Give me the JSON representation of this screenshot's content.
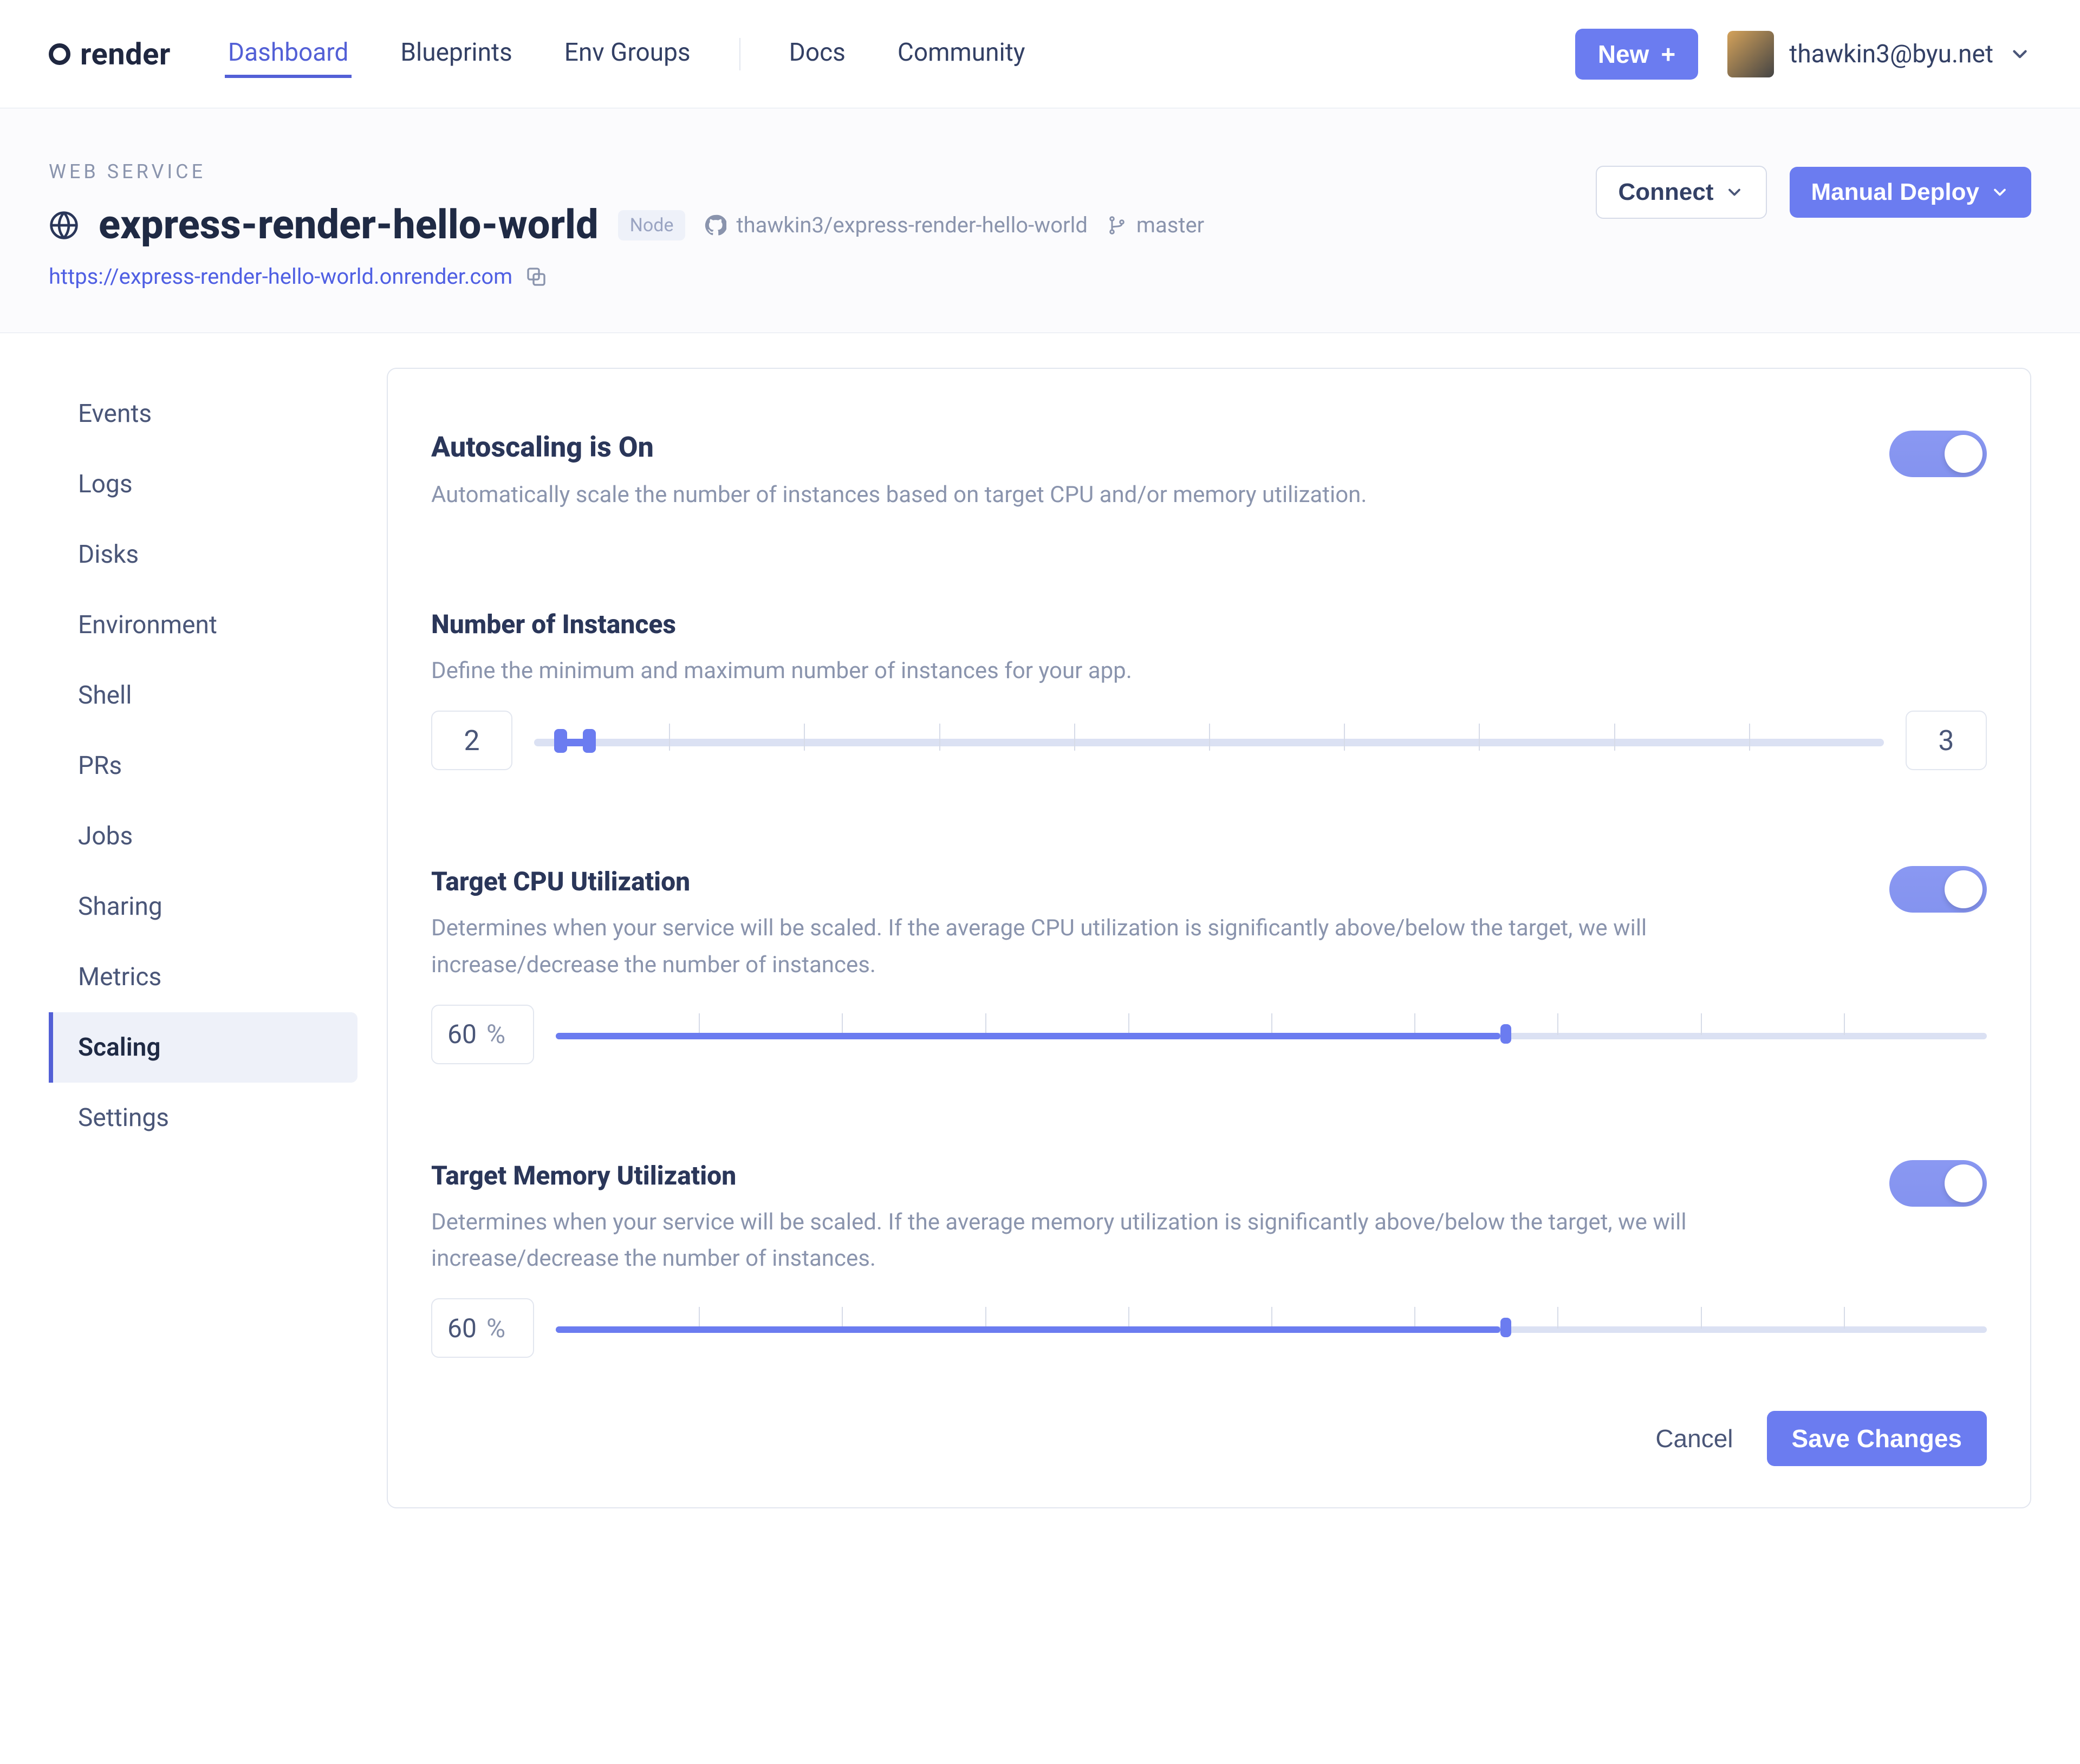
{
  "nav": {
    "brand": "render",
    "items": [
      "Dashboard",
      "Blueprints",
      "Env Groups",
      "Docs",
      "Community"
    ],
    "active_index": 0,
    "new_label": "New",
    "user_email": "thawkin3@byu.net"
  },
  "header": {
    "kicker": "WEB SERVICE",
    "title": "express-render-hello-world",
    "badge": "Node",
    "repo": "thawkin3/express-render-hello-world",
    "branch": "master",
    "url_text": "https://express-render-hello-world.onrender.com",
    "connect_label": "Connect",
    "deploy_label": "Manual Deploy"
  },
  "sidebar": {
    "items": [
      "Events",
      "Logs",
      "Disks",
      "Environment",
      "Shell",
      "PRs",
      "Jobs",
      "Sharing",
      "Metrics",
      "Scaling",
      "Settings"
    ],
    "active_index": 9
  },
  "autoscale": {
    "title": "Autoscaling is On",
    "desc": "Automatically scale the number of instances based on target CPU and/or memory utilization.",
    "enabled": true
  },
  "instances": {
    "title": "Number of Instances",
    "desc": "Define the minimum and maximum number of instances for your app.",
    "min": "2",
    "max": "3",
    "range_min": 1,
    "range_max": 50
  },
  "cpu": {
    "title": "Target CPU Utilization",
    "desc": "Determines when your service will be scaled. If the average CPU utilization is significantly above/below the target, we will increase/decrease the number of instances.",
    "value": "60",
    "unit": "%",
    "enabled": true
  },
  "memory": {
    "title": "Target Memory Utilization",
    "desc": "Determines when your service will be scaled. If the average memory utilization is significantly above/below the target, we will increase/decrease the number of instances.",
    "value": "60",
    "unit": "%",
    "enabled": true
  },
  "actions": {
    "cancel": "Cancel",
    "save": "Save Changes"
  }
}
